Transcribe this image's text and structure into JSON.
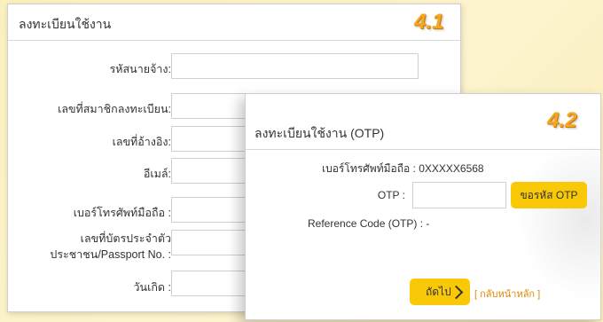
{
  "panel1": {
    "title": "ลงทะเบียนใช้งาน",
    "step": "4.1",
    "fields": [
      {
        "label": "รหัสนายจ้าง:"
      },
      {
        "label": "เลขที่สมาชิกลงทะเบียน:"
      },
      {
        "label": "เลขที่อ้างอิง:"
      },
      {
        "label": "อีเมล์:"
      },
      {
        "label": "เบอร์โทรศัพท์มือถือ :"
      },
      {
        "label_line1": "เลขที่บัตรประจำตัว",
        "label_line2": "ประชาชน/Passport No. :"
      },
      {
        "label": "วันเกิด :"
      }
    ]
  },
  "panel2": {
    "title": "ลงทะเบียนใช้งาน (OTP)",
    "step": "4.2",
    "phone_label": "เบอร์โทรศัพท์มือถือ : 0XXXXX6568",
    "otp_label": "OTP :",
    "otp_value": "",
    "request_otp_button": "ขอรหัส OTP",
    "reference_label": "Reference Code (OTP) : -",
    "next_button": "ถัดไป",
    "back_link": "[ กลับหน้าหลัก ]"
  },
  "colors": {
    "accent_yellow": "#f9c908",
    "step_orange": "#f5a623",
    "link_orange": "#e08a00",
    "background": "#fbf0bf"
  }
}
